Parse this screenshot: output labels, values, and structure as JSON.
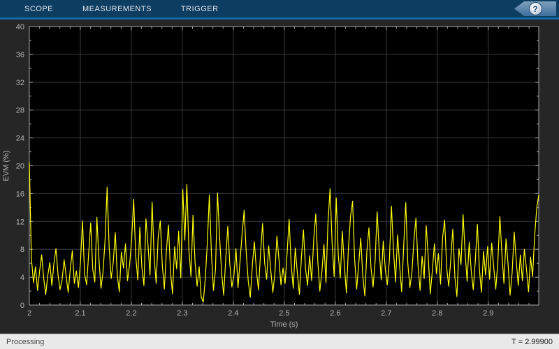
{
  "toolbar": {
    "tabs": [
      {
        "label": "SCOPE"
      },
      {
        "label": "MEASUREMENTS"
      },
      {
        "label": "TRIGGER"
      }
    ],
    "help_icon": "question-mark-icon",
    "help_glyph": "?"
  },
  "status_bar": {
    "left": "Processing",
    "right": "T = 2.99900"
  },
  "colors": {
    "toolbar_bg": "#0e3d62",
    "toolbar_accent": "#1668a8",
    "panel_bg": "#262626",
    "plot_bg": "#000000",
    "trace": "#ffff00",
    "grid": "#3c3c3c",
    "axis_border": "#a8a8a8",
    "tick_label": "#b4b4b4",
    "status_bg": "#e9e9e9"
  },
  "chart_data": {
    "type": "line",
    "title": "",
    "xlabel": "Time (s)",
    "ylabel": "EVM (%)",
    "xlim": [
      2.0,
      2.999
    ],
    "ylim": [
      0,
      40
    ],
    "grid": true,
    "legend": null,
    "xticks": {
      "values": [
        2.0,
        2.1,
        2.2,
        2.3,
        2.4,
        2.5,
        2.6,
        2.7,
        2.8,
        2.9
      ],
      "labels": [
        "2",
        "2.1",
        "2.2",
        "2.3",
        "2.4",
        "2.5",
        "2.6",
        "2.7",
        "2.8",
        "2.9"
      ]
    },
    "yticks": {
      "values": [
        0,
        4,
        8,
        12,
        16,
        20,
        24,
        28,
        32,
        36,
        40
      ],
      "labels": [
        "0",
        "4",
        "8",
        "12",
        "16",
        "20",
        "24",
        "28",
        "32",
        "36",
        "40"
      ]
    },
    "minor_x_step": 0.02,
    "minor_y_step": 2,
    "series": [
      {
        "name": "EVM",
        "color": "#ffff00",
        "x_uniform_over_xlim": true,
        "y": [
          20.5,
          6.8,
          3.2,
          5.5,
          2.1,
          4.8,
          7.2,
          3.9,
          1.5,
          4.2,
          6.1,
          2.8,
          5.9,
          8.1,
          4.4,
          2.2,
          3.6,
          6.5,
          4.1,
          1.8,
          5.2,
          7.8,
          3.1,
          4.9,
          2.5,
          6.2,
          12.1,
          4.5,
          2.9,
          7.4,
          11.8,
          5.1,
          3.3,
          12.6,
          6.8,
          2.4,
          4.7,
          9.2,
          16.9,
          8.3,
          3.8,
          6.1,
          10.4,
          4.2,
          1.9,
          7.6,
          5.3,
          8.8,
          3.5,
          5.8,
          9.4,
          15.2,
          7.1,
          3.6,
          11.2,
          5.4,
          2.8,
          12.4,
          8.6,
          4.3,
          14.8,
          6.9,
          3.1,
          9.8,
          12.1,
          5.7,
          2.3,
          7.9,
          11.5,
          4.8,
          1.6,
          8.4,
          5.2,
          10.6,
          3.9,
          16.6,
          9.3,
          17.3,
          7.8,
          4.1,
          12.9,
          6.2,
          2.7,
          5.5,
          1.2,
          0.4,
          3.8,
          8.9,
          15.8,
          7.4,
          2.1,
          5.1,
          16.1,
          9.7,
          4.6,
          1.4,
          6.7,
          11.3,
          5.9,
          2.6,
          4.3,
          8.1,
          2.5,
          6.4,
          10.2,
          13.6,
          7.7,
          3.4,
          1.1,
          5.6,
          9.1,
          4.9,
          2.2,
          7.3,
          11.7,
          6.1,
          3.7,
          8.5,
          5.0,
          1.8,
          4.4,
          9.9,
          6.6,
          2.9,
          5.3,
          3.1,
          7.5,
          12.3,
          5.8,
          2.4,
          8.2,
          4.6,
          1.5,
          6.9,
          10.8,
          5.2,
          2.8,
          7.1,
          3.5,
          9.4,
          13.1,
          6.3,
          2.0,
          4.8,
          8.7,
          3.2,
          11.9,
          16.7,
          8.9,
          4.1,
          15.4,
          7.2,
          3.9,
          10.6,
          5.5,
          1.7,
          8.3,
          12.8,
          14.9,
          6.7,
          2.3,
          5.9,
          9.6,
          4.2,
          1.3,
          7.8,
          11.1,
          5.4,
          2.6,
          6.2,
          13.4,
          8.0,
          3.6,
          9.2,
          5.1,
          2.9,
          6.5,
          14.2,
          7.9,
          3.3,
          10.1,
          5.7,
          1.9,
          8.6,
          14.7,
          6.0,
          2.5,
          4.7,
          9.3,
          12.5,
          5.6,
          2.1,
          7.0,
          3.8,
          11.4,
          6.8,
          1.6,
          5.0,
          8.8,
          4.5,
          7.4,
          3.0,
          9.7,
          12.2,
          5.3,
          2.7,
          6.6,
          10.9,
          4.0,
          1.2,
          8.1,
          5.8,
          13.0,
          7.6,
          3.4,
          9.0,
          4.9,
          2.2,
          6.3,
          11.6,
          5.1,
          1.8,
          7.7,
          4.3,
          8.4,
          3.7,
          8.9,
          5.4,
          2.3,
          6.1,
          12.7,
          7.3,
          3.1,
          9.5,
          5.9,
          1.4,
          4.6,
          10.5,
          6.4,
          2.8,
          7.2,
          3.5,
          8.0,
          5.2,
          1.9,
          6.9,
          4.1,
          9.8,
          13.9,
          15.8
        ]
      }
    ]
  }
}
